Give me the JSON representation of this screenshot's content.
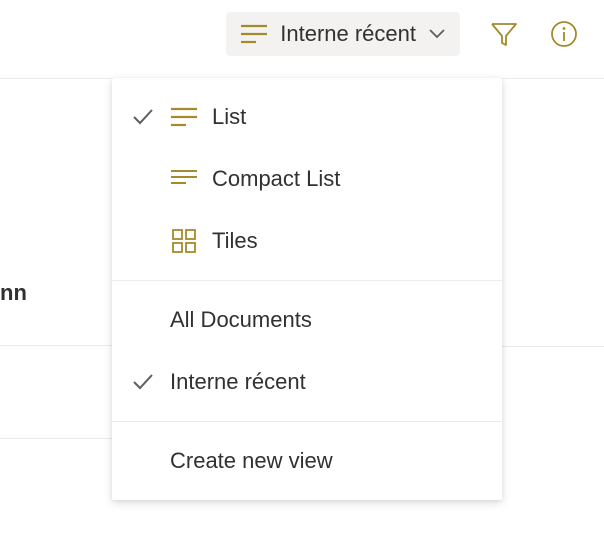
{
  "colors": {
    "accent": "#a38a2a",
    "text": "#323130",
    "check": "#605e5c"
  },
  "toolbar": {
    "current_view_label": "Interne récent"
  },
  "column_header": "nn",
  "dropdown": {
    "layouts": [
      {
        "label": "List",
        "icon": "list-icon",
        "selected": true
      },
      {
        "label": "Compact List",
        "icon": "compact-list-icon",
        "selected": false
      },
      {
        "label": "Tiles",
        "icon": "tiles-icon",
        "selected": false
      }
    ],
    "views": [
      {
        "label": "All Documents",
        "selected": false
      },
      {
        "label": "Interne récent",
        "selected": true
      }
    ],
    "create_label": "Create new view"
  }
}
